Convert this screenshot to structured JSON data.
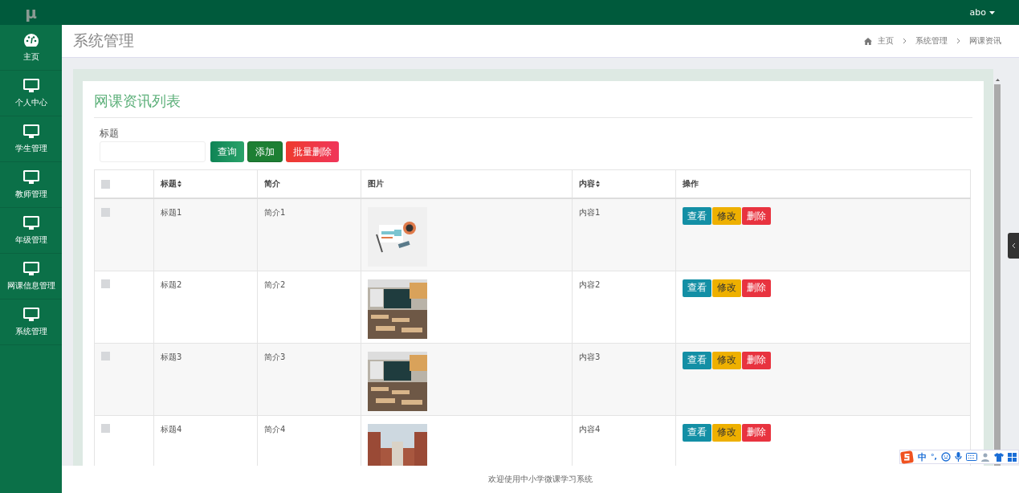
{
  "logo": "μ",
  "user": {
    "name": "abo"
  },
  "sidebar": {
    "items": [
      {
        "label": "主页",
        "kind": "dashboard",
        "selected": false
      },
      {
        "label": "个人中心",
        "kind": "monitor",
        "selected": false
      },
      {
        "label": "学生管理",
        "kind": "monitor",
        "selected": false
      },
      {
        "label": "教师管理",
        "kind": "monitor",
        "selected": false
      },
      {
        "label": "年级管理",
        "kind": "monitor",
        "selected": false
      },
      {
        "label": "网课信息管理",
        "kind": "monitor",
        "selected": false
      },
      {
        "label": "系统管理",
        "kind": "monitor",
        "selected": false
      }
    ]
  },
  "page_title": "系统管理",
  "breadcrumb": [
    "主页",
    "系统管理",
    "网课资讯"
  ],
  "card": {
    "title": "网课资讯列表",
    "search": {
      "label": "标题"
    },
    "buttons": [
      {
        "label": "查询",
        "kind": "search"
      },
      {
        "label": "添加",
        "kind": "add"
      },
      {
        "label": "批量删除",
        "kind": "delete"
      }
    ],
    "table": {
      "header_checked": false,
      "columns": [
        {
          "label": "标题",
          "sortable": true
        },
        {
          "label": "简介",
          "sortable": false
        },
        {
          "label": "图片",
          "sortable": false
        },
        {
          "label": "内容",
          "sortable": true
        },
        {
          "label": "操作",
          "sortable": false
        }
      ],
      "rows": [
        {
          "checked": false,
          "title": "标题1",
          "intro": "简介1",
          "image": {
            "kind": "picture"
          },
          "content": "内容1",
          "actions": [
            "查看",
            "修改",
            "删除"
          ]
        },
        {
          "checked": false,
          "title": "标题2",
          "intro": "简介2",
          "image": {
            "kind": "picture"
          },
          "content": "内容2",
          "actions": [
            "查看",
            "修改",
            "删除"
          ]
        },
        {
          "checked": false,
          "title": "标题3",
          "intro": "简介3",
          "image": {
            "kind": "picture"
          },
          "content": "内容3",
          "actions": [
            "查看",
            "修改",
            "删除"
          ]
        },
        {
          "checked": false,
          "title": "标题4",
          "intro": "简介4",
          "image": {
            "kind": "picture"
          },
          "content": "内容4",
          "actions": [
            "查看",
            "修改",
            "删除"
          ]
        }
      ]
    }
  },
  "footer": "欢迎使用中小学微课学习系统",
  "ime_toolbar": {
    "mode": "中",
    "punctuation": "°,"
  }
}
